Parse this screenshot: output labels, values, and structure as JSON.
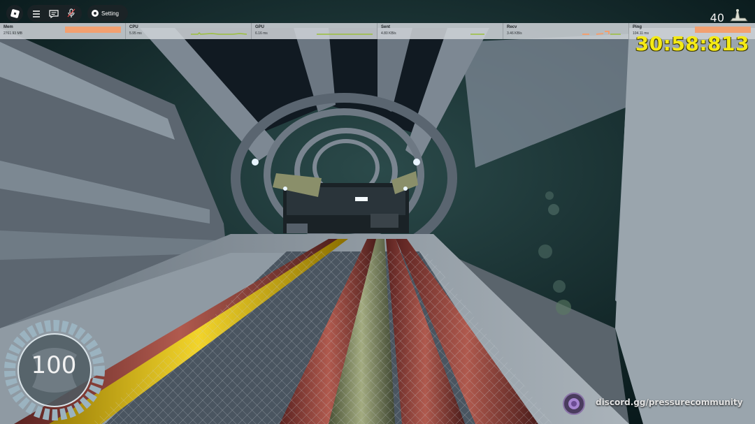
{
  "topbar": {
    "settings_label": "Setting",
    "icons": [
      "roblox-logo-icon",
      "menu-icon",
      "chat-icon",
      "mic-muted-icon",
      "settings-icon"
    ]
  },
  "stats": [
    {
      "label": "Mem",
      "value": "2761.93 MB"
    },
    {
      "label": "CPU",
      "value": "5.95 ms"
    },
    {
      "label": "GPU",
      "value": "6.16 ms"
    },
    {
      "label": "Sent",
      "value": "4.80 KB/s"
    },
    {
      "label": "Recv",
      "value": "3.46 KB/s"
    },
    {
      "label": "Ping",
      "value": "104.11 ms"
    }
  ],
  "hud": {
    "counter": "40",
    "timer": "30:58:813",
    "health": "100",
    "discord": "discord.gg/pressurecommunity"
  },
  "colors": {
    "accent_orange": "#f2a070",
    "timer_yellow": "#f4ea16",
    "pipe_yellow": "#e8c21a",
    "pipe_red": "#8a3a34",
    "pipe_olive": "#7c8560"
  }
}
